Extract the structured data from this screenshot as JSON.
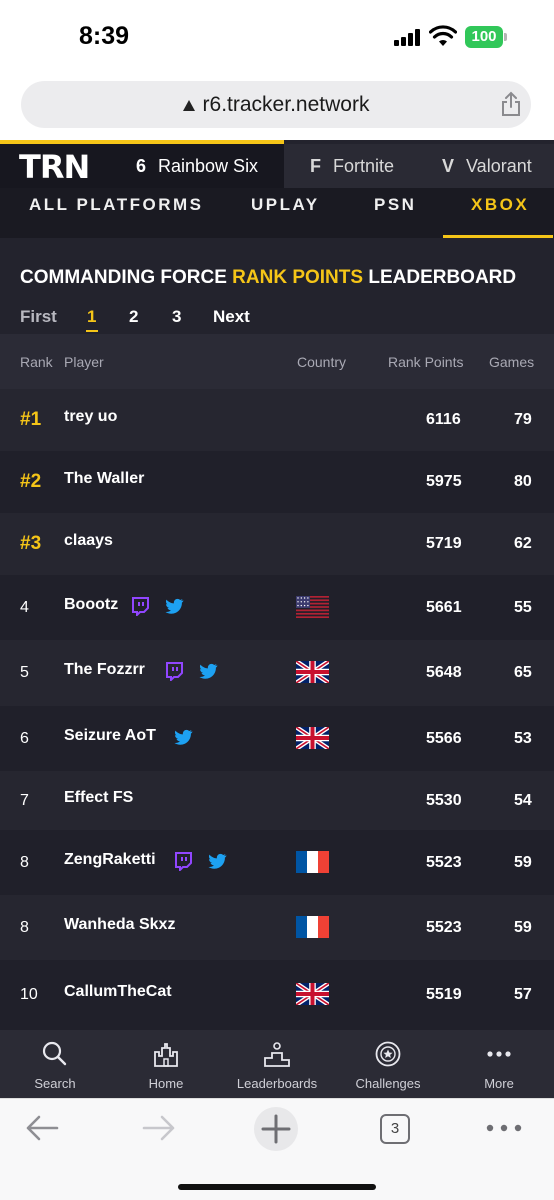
{
  "status_bar": {
    "time": "8:39",
    "battery": "100"
  },
  "browser": {
    "url": "r6.tracker.network",
    "tabs_count": "3"
  },
  "site": {
    "logo": "TRN",
    "games": [
      {
        "label": "Rainbow Six",
        "icon": "6"
      },
      {
        "label": "Fortnite",
        "icon": "F"
      },
      {
        "label": "Valorant",
        "icon": "V"
      }
    ],
    "platforms": [
      "ALL PLATFORMS",
      "UPLAY",
      "PSN",
      "XBOX"
    ],
    "active_platform": "XBOX"
  },
  "leaderboard": {
    "title_pre": "COMMANDING FORCE ",
    "title_highlight": "RANK POINTS",
    "title_post": " LEADERBOARD",
    "pager": {
      "first": "First",
      "pages": [
        "1",
        "2",
        "3"
      ],
      "next": "Next",
      "current": "1"
    },
    "columns": {
      "rank": "Rank",
      "player": "Player",
      "country": "Country",
      "points": "Rank Points",
      "games": "Games"
    },
    "rows": [
      {
        "rank": "#1",
        "player": "trey uo",
        "twitch": false,
        "twitter": false,
        "country": "",
        "points": "6116",
        "games": "79"
      },
      {
        "rank": "#2",
        "player": "The Waller",
        "twitch": false,
        "twitter": false,
        "country": "",
        "points": "5975",
        "games": "80"
      },
      {
        "rank": "#3",
        "player": "claays",
        "twitch": false,
        "twitter": false,
        "country": "",
        "points": "5719",
        "games": "62"
      },
      {
        "rank": "4",
        "player": "Boootz",
        "twitch": true,
        "twitter": true,
        "country": "us",
        "points": "5661",
        "games": "55"
      },
      {
        "rank": "5",
        "player": "The Fozzrr",
        "twitch": true,
        "twitter": true,
        "country": "gb",
        "points": "5648",
        "games": "65"
      },
      {
        "rank": "6",
        "player": "Seizure AoT",
        "twitch": false,
        "twitter": true,
        "country": "gb",
        "points": "5566",
        "games": "53"
      },
      {
        "rank": "7",
        "player": "Effect FS",
        "twitch": false,
        "twitter": false,
        "country": "",
        "points": "5530",
        "games": "54"
      },
      {
        "rank": "8",
        "player": "ZengRaketti",
        "twitch": true,
        "twitter": true,
        "country": "fr",
        "points": "5523",
        "games": "59"
      },
      {
        "rank": "8",
        "player": "Wanheda Skxz",
        "twitch": false,
        "twitter": false,
        "country": "fr",
        "points": "5523",
        "games": "59"
      },
      {
        "rank": "10",
        "player": "CallumTheCat",
        "twitch": false,
        "twitter": false,
        "country": "gb",
        "points": "5519",
        "games": "57"
      }
    ]
  },
  "app_nav": [
    {
      "label": "Search",
      "icon": "search-icon"
    },
    {
      "label": "Home",
      "icon": "castle-icon"
    },
    {
      "label": "Leaderboards",
      "icon": "podium-icon"
    },
    {
      "label": "Challenges",
      "icon": "badge-icon"
    },
    {
      "label": "More",
      "icon": "more-icon"
    }
  ],
  "colors": {
    "accent": "#f5c518",
    "page_bg": "#23232d",
    "twitch": "#9146ff",
    "twitter": "#1da1f2"
  }
}
